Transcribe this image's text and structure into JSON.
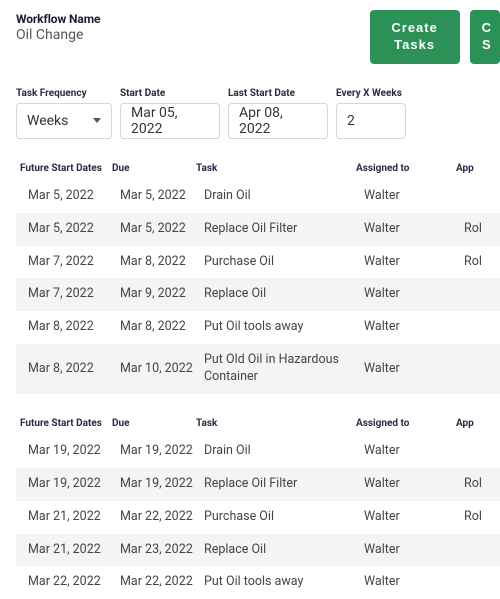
{
  "header": {
    "workflow_label": "Workflow Name",
    "workflow_value": "Oil Change",
    "create_tasks_button": "Create\nTasks",
    "cut_button": "C\nS"
  },
  "controls": {
    "task_frequency_label": "Task Frequency",
    "task_frequency_value": "Weeks",
    "start_date_label": "Start Date",
    "start_date_value": "Mar 05, 2022",
    "last_start_date_label": "Last Start Date",
    "last_start_date_value": "Apr 08, 2022",
    "every_x_label": "Every X Weeks",
    "every_x_value": "2"
  },
  "columns": {
    "future_start": "Future Start Dates",
    "due": "Due",
    "task": "Task",
    "assigned": "Assigned to",
    "approver": "App"
  },
  "groups": [
    {
      "rows": [
        {
          "start": "Mar 5, 2022",
          "due": "Mar 5, 2022",
          "task": "Drain Oil",
          "assigned": "Walter",
          "approver": ""
        },
        {
          "start": "Mar 5, 2022",
          "due": "Mar 5, 2022",
          "task": "Replace Oil Filter",
          "assigned": "Walter",
          "approver": "Rol"
        },
        {
          "start": "Mar 7, 2022",
          "due": "Mar 8, 2022",
          "task": "Purchase Oil",
          "assigned": "Walter",
          "approver": "Rol"
        },
        {
          "start": "Mar 7, 2022",
          "due": "Mar 9, 2022",
          "task": "Replace Oil",
          "assigned": "Walter",
          "approver": ""
        },
        {
          "start": "Mar 8, 2022",
          "due": "Mar 8, 2022",
          "task": "Put Oil tools away",
          "assigned": "Walter",
          "approver": ""
        },
        {
          "start": "Mar 8, 2022",
          "due": "Mar 10, 2022",
          "task": "Put Old Oil in Hazardous Container",
          "assigned": "Walter",
          "approver": ""
        }
      ]
    },
    {
      "rows": [
        {
          "start": "Mar 19, 2022",
          "due": "Mar 19, 2022",
          "task": "Drain Oil",
          "assigned": "Walter",
          "approver": ""
        },
        {
          "start": "Mar 19, 2022",
          "due": "Mar 19, 2022",
          "task": "Replace Oil Filter",
          "assigned": "Walter",
          "approver": "Rol"
        },
        {
          "start": "Mar 21, 2022",
          "due": "Mar 22, 2022",
          "task": "Purchase Oil",
          "assigned": "Walter",
          "approver": "Rol"
        },
        {
          "start": "Mar 21, 2022",
          "due": "Mar 23, 2022",
          "task": "Replace Oil",
          "assigned": "Walter",
          "approver": ""
        },
        {
          "start": "Mar 22, 2022",
          "due": "Mar 22, 2022",
          "task": "Put Oil tools away",
          "assigned": "Walter",
          "approver": ""
        }
      ]
    }
  ]
}
